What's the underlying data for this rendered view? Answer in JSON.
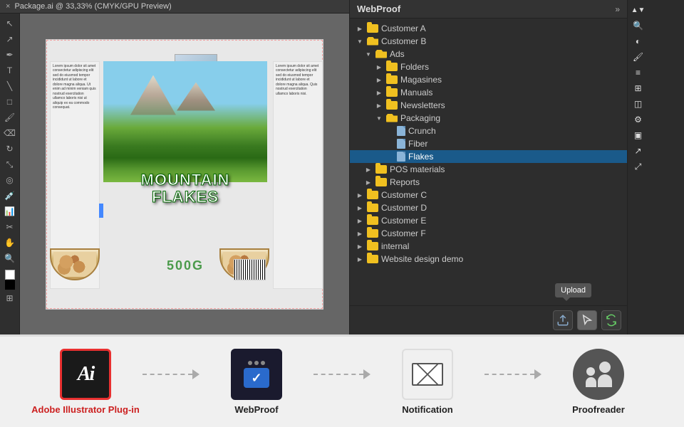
{
  "title_bar": {
    "close": "×",
    "text": "Package.ai @ 33,33% (CMYK/GPU Preview)"
  },
  "webproof": {
    "title": "WebProof",
    "expand_icon": "»",
    "tree": [
      {
        "id": "customer-a",
        "label": "Customer A",
        "type": "folder",
        "indent": 0,
        "open": false
      },
      {
        "id": "customer-b",
        "label": "Customer B",
        "type": "folder",
        "indent": 0,
        "open": true
      },
      {
        "id": "ads",
        "label": "Ads",
        "type": "folder",
        "indent": 1,
        "open": true
      },
      {
        "id": "folders",
        "label": "Folders",
        "type": "folder",
        "indent": 2,
        "open": false
      },
      {
        "id": "magasines",
        "label": "Magasines",
        "type": "folder",
        "indent": 2,
        "open": false
      },
      {
        "id": "manuals",
        "label": "Manuals",
        "type": "folder",
        "indent": 2,
        "open": false
      },
      {
        "id": "newsletters",
        "label": "Newsletters",
        "type": "folder",
        "indent": 2,
        "open": false
      },
      {
        "id": "packaging",
        "label": "Packaging",
        "type": "folder",
        "indent": 2,
        "open": true
      },
      {
        "id": "crunch",
        "label": "Crunch",
        "type": "file",
        "indent": 3
      },
      {
        "id": "fiber",
        "label": "Fiber",
        "type": "file",
        "indent": 3
      },
      {
        "id": "flakes",
        "label": "Flakes",
        "type": "file",
        "indent": 3,
        "selected": true
      },
      {
        "id": "pos-materials",
        "label": "POS materials",
        "type": "folder",
        "indent": 1,
        "open": false
      },
      {
        "id": "reports",
        "label": "Reports",
        "type": "folder",
        "indent": 1,
        "open": false
      },
      {
        "id": "customer-c",
        "label": "Customer C",
        "type": "folder",
        "indent": 0,
        "open": false
      },
      {
        "id": "customer-d",
        "label": "Customer D",
        "type": "folder",
        "indent": 0,
        "open": false
      },
      {
        "id": "customer-e",
        "label": "Customer E",
        "type": "folder",
        "indent": 0,
        "open": false
      },
      {
        "id": "customer-f",
        "label": "Customer F",
        "type": "folder",
        "indent": 0,
        "open": false
      },
      {
        "id": "internal",
        "label": "internal",
        "type": "folder",
        "indent": 0,
        "open": false
      },
      {
        "id": "website-demo",
        "label": "Website design demo",
        "type": "folder",
        "indent": 0,
        "open": false
      }
    ],
    "upload_tooltip": "Upload",
    "footer_buttons": [
      "upload",
      "cursor",
      "settings"
    ]
  },
  "workflow": {
    "steps": [
      {
        "id": "illustrator",
        "label": "Adobe Illustrator Plug-in",
        "icon_type": "ai"
      },
      {
        "id": "webproof",
        "label": "WebProof",
        "icon_type": "webproof"
      },
      {
        "id": "notification",
        "label": "Notification",
        "icon_type": "notification"
      },
      {
        "id": "proofreader",
        "label": "Proofreader",
        "icon_type": "proofreader"
      }
    ]
  },
  "cereal": {
    "title_line1": "MOUNTAIN",
    "title_line2": "FLAKES",
    "weight": "500G"
  },
  "colors": {
    "ai_border": "#e83030",
    "ai_label": "#cc2020",
    "selected_bg": "#1a5a8a",
    "webproof_check": "#2a6acc"
  }
}
